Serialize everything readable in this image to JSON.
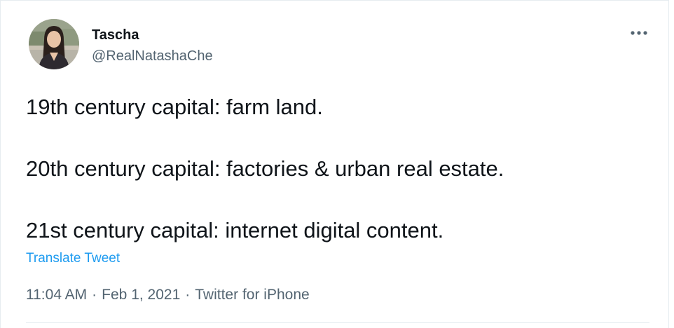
{
  "tweet": {
    "author": {
      "display_name": "Tascha",
      "handle": "@RealNatashaChe"
    },
    "lines": [
      "19th century capital: farm land.",
      "20th century capital: factories & urban real estate.",
      "21st century capital: internet digital content."
    ],
    "translate_label": "Translate Tweet",
    "meta": {
      "time": "11:04 AM",
      "date": "Feb 1, 2021",
      "source": "Twitter for iPhone",
      "separator": "·"
    }
  },
  "icons": {
    "more": "more-dots-icon",
    "avatar": "profile-photo"
  },
  "colors": {
    "text": "#0f1419",
    "secondary": "#536471",
    "link": "#1d9bf0",
    "border": "#e6ecf0"
  }
}
